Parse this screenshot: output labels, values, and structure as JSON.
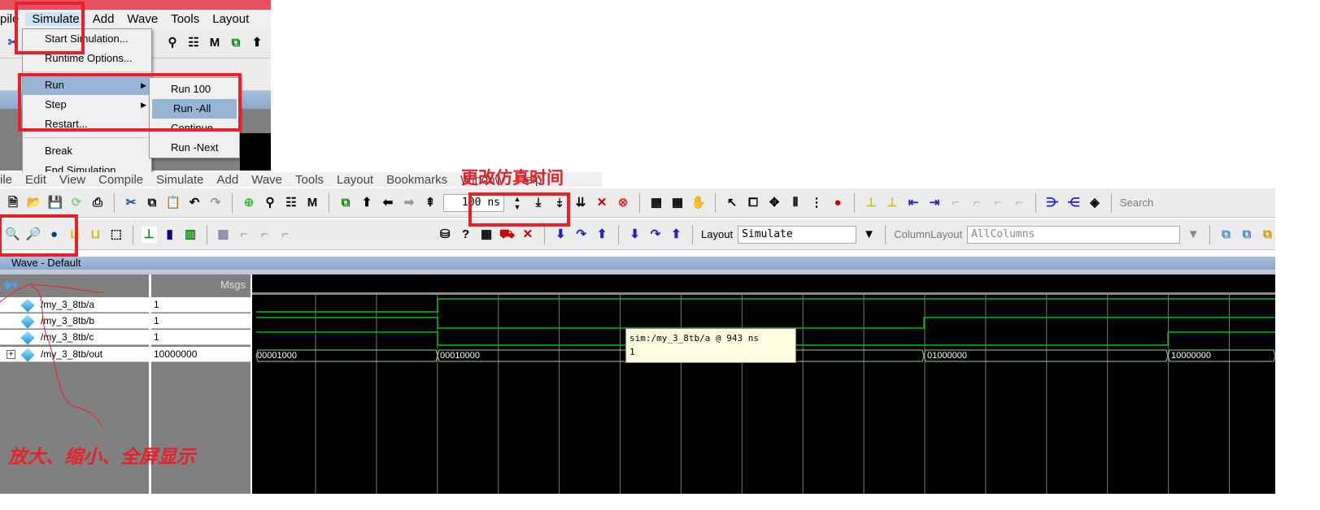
{
  "top_screenshot": {
    "menubar": [
      "pile",
      "Simulate",
      "Add",
      "Wave",
      "Tools",
      "Layout"
    ],
    "simulate_menu": [
      "Start Simulation...",
      "Runtime Options...",
      "Run",
      "Step",
      "Restart...",
      "Break",
      "End Simulation"
    ],
    "run_submenu": [
      "Run 100",
      "Run -All",
      "Continue",
      "Run -Next"
    ],
    "highlighted": {
      "menu": "Run",
      "submenu": "Run -All"
    }
  },
  "annotations": {
    "change_time": "更改仿真时间",
    "zoom_note": "放大、缩小、全屏显示",
    "color": "#e8202a"
  },
  "main": {
    "menubar": [
      "ile",
      "Edit",
      "View",
      "Compile",
      "Simulate",
      "Add",
      "Wave",
      "Tools",
      "Layout",
      "Bookmarks",
      "Window",
      "Help"
    ],
    "run_length": "100 ns",
    "layout_label": "Layout",
    "layout_value": "Simulate",
    "column_layout_label": "ColumnLayout",
    "column_layout_value": "AllColumns",
    "search_label": "Search",
    "wave_title": "Wave - Default",
    "msgs_header": "Msgs",
    "signals": [
      {
        "name": "/my_3_8tb/a",
        "value": "1"
      },
      {
        "name": "/my_3_8tb/b",
        "value": "1"
      },
      {
        "name": "/my_3_8tb/c",
        "value": "1"
      },
      {
        "name": "/my_3_8tb/out",
        "value": "10000000",
        "expand": "+"
      }
    ],
    "bus_values": [
      "00001000",
      "00010000",
      "01000000",
      "10000000"
    ],
    "tooltip": {
      "line1": "sim:/my_3_8tb/a @ 943 ns",
      "line2": "1"
    },
    "wave_color": "#00c000"
  }
}
